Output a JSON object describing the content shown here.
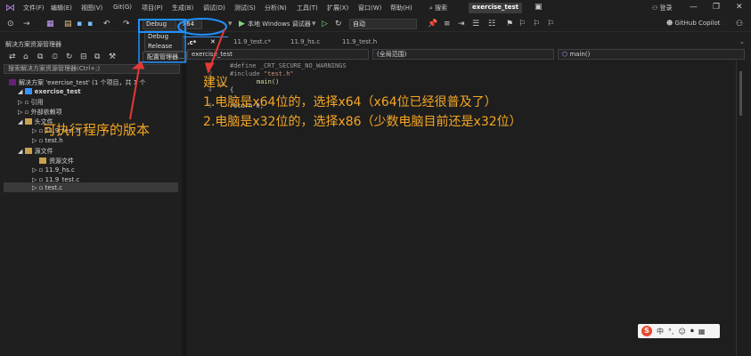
{
  "menubar": {
    "items": [
      "文件(F)",
      "编辑(E)",
      "视图(V)",
      "Git(G)",
      "项目(P)",
      "生成(B)",
      "调试(D)",
      "测试(S)",
      "分析(N)",
      "工具(T)",
      "扩展(X)",
      "窗口(W)",
      "帮助(H)"
    ],
    "search": "搜索",
    "project_title": "exercise_test",
    "login": "登录"
  },
  "toolbar": {
    "config": "Debug",
    "platform": "x64",
    "run_target": "本地 Windows 调试器",
    "auto": "自动",
    "copilot": "GitHub Copilot"
  },
  "dropdown": {
    "options": [
      "Debug",
      "Release"
    ],
    "config_manager": "配置管理器..."
  },
  "explorer": {
    "title": "解决方案资源管理器",
    "search_placeholder": "搜索解决方案资源管理器(Ctrl+;)",
    "solution": "解决方案 'exercise_test' (1 个项目，共 1 个",
    "project": "exercise_test",
    "references": "引用",
    "external_deps": "外部依赖项",
    "header_files": "头文件",
    "header_item": "11.9_test.h",
    "header_item2": "test.h",
    "source_files": "源文件",
    "resource_files": "资源文件",
    "source_items": [
      "11.9_hs.c",
      "11.9_test.c",
      "test.c"
    ]
  },
  "tabs": [
    "exercise_test",
    ".c*",
    "11.9_test.c*",
    "11.9_hs.c",
    "11.9_test.h"
  ],
  "navbar": {
    "project": "exercise_test",
    "scope": "(全局范围)",
    "function": "main()"
  },
  "editor": {
    "lines": [
      {
        "no": "1",
        "pp": "#define",
        "rest": " _CRT_SECURE_NO_WARNINGS"
      },
      {
        "no": "2",
        "pp": "#include",
        "rest": " \"test.h\""
      },
      {
        "no": "3",
        "pp": "",
        "rest": "main()"
      },
      {
        "no": "4",
        "pp": "",
        "rest": "{"
      },
      {
        "no": "5",
        "pp": "",
        "rest": "    return 0;"
      }
    ]
  },
  "annotations": {
    "left": "可执行程序的版本",
    "heading": "建议",
    "line1": "1.电脑是x64位的，选择x64（x64位已经很普及了）",
    "line2": "2.电脑是x32位的，选择x86（少数电脑目前还是x32位）"
  },
  "ime": {
    "items": [
      "中",
      "°,",
      "☺",
      "⏺",
      "▦"
    ]
  },
  "colors": {
    "accent_blue": "#1e90ff",
    "annotation_orange": "#f5a623",
    "arrow_red": "#e53935"
  }
}
